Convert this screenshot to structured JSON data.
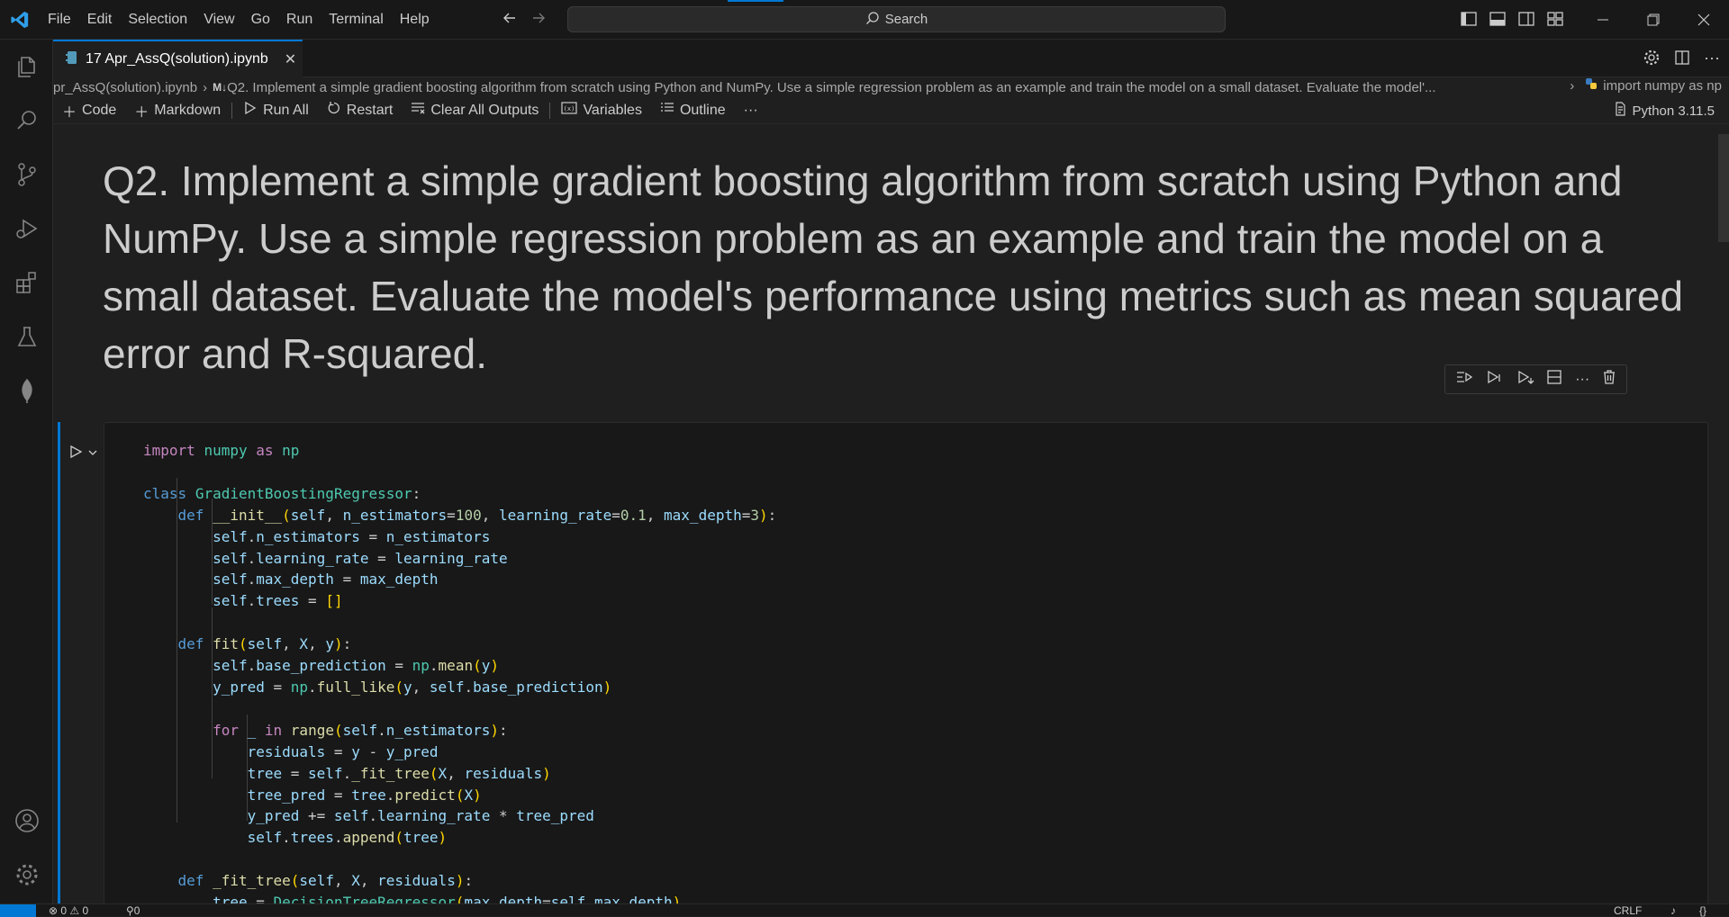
{
  "menu": [
    "File",
    "Edit",
    "Selection",
    "View",
    "Go",
    "Run",
    "Terminal",
    "Help"
  ],
  "search": {
    "label": "Search"
  },
  "tab": {
    "title": "17 Apr_AssQ(solution).ipynb"
  },
  "breadcrumb": {
    "file": "pr_AssQ(solution).ipynb",
    "md_badge": "M↓",
    "section": "Q2. Implement a simple gradient boosting algorithm from scratch using Python and NumPy. Use a simple regression problem as an example and train the model on a small dataset. Evaluate the model'...",
    "cell": "import numpy as np"
  },
  "toolbar": {
    "code": "Code",
    "markdown": "Markdown",
    "run_all": "Run All",
    "restart": "Restart",
    "clear_outputs": "Clear All Outputs",
    "variables": "Variables",
    "outline": "Outline",
    "more": "···",
    "kernel": "Python 3.11.5"
  },
  "markdown_cell": {
    "text": "Q2. Implement a simple gradient boosting algorithm from scratch using Python and NumPy. Use a simple regression problem as an example and train the model on a small dataset. Evaluate the model's performance using metrics such as mean squared error and R-squared."
  },
  "status": {
    "errors": "0",
    "warnings": "0",
    "ports": "0",
    "eol": "CRLF"
  },
  "colors": {
    "accent": "#0078d4",
    "keyword": "#569cd6",
    "control": "#c586c0",
    "class": "#4ec9b0",
    "function": "#dcdcaa",
    "variable": "#9cdcfe",
    "number": "#b5cea8"
  },
  "icons": [
    "vscode-logo-icon",
    "explorer-icon",
    "search-icon",
    "source-control-icon",
    "run-debug-icon",
    "extensions-icon",
    "testing-icon",
    "mongodb-icon",
    "account-icon",
    "settings-gear-icon"
  ]
}
